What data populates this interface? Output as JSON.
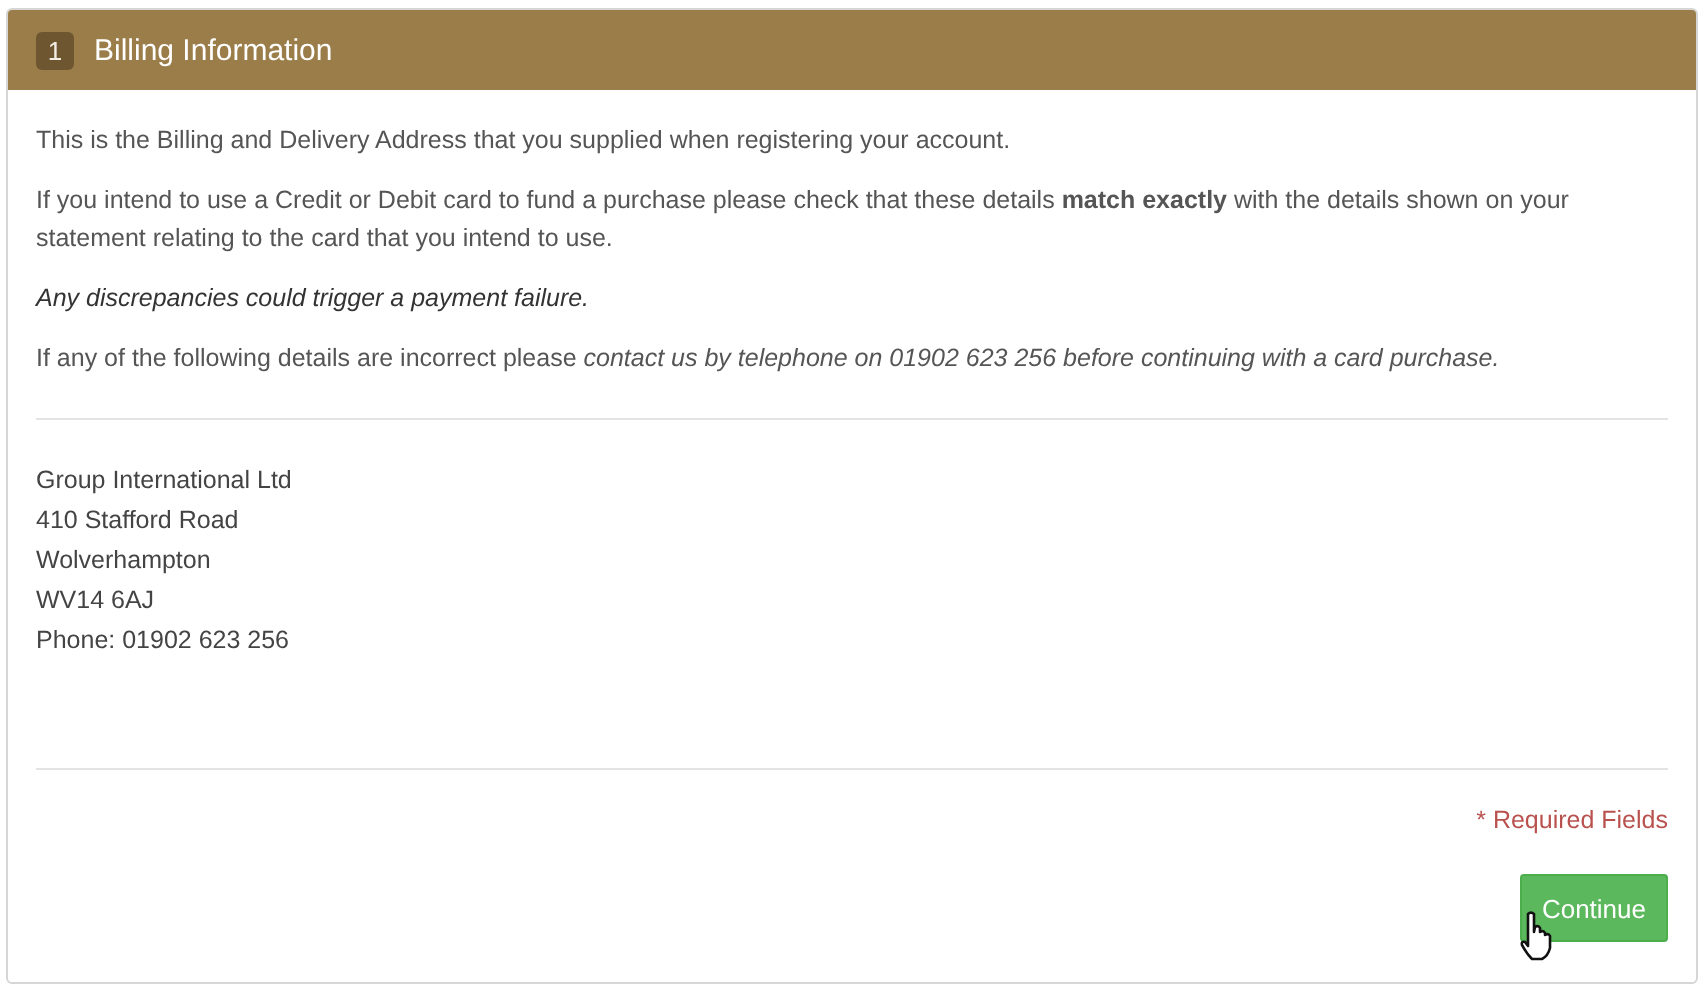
{
  "panel": {
    "step": "1",
    "title": "Billing Information"
  },
  "paragraphs": [
    {
      "kind": "plain",
      "text": "This is the Billing and Delivery Address that you supplied when registering your account."
    },
    {
      "kind": "plain",
      "text": "If you intend to use a Credit or Debit card to fund a purchase please check that these details **match exactly** with the details shown on your statement relating to the card that you intend to use."
    },
    {
      "kind": "emphasis",
      "text": "Any discrepancies could trigger a payment failure."
    },
    {
      "kind": "plain",
      "text": "If any of the following details are incorrect please *contact us by telephone on 01902 623 256 before continuing with a card purchase.*"
    }
  ],
  "address": [
    "Group International Ltd",
    "410 Stafford Road",
    "Wolverhampton",
    "WV14 6AJ",
    "Phone: 01902 623 256"
  ],
  "required_note": "* Required Fields",
  "button": "Continue"
}
